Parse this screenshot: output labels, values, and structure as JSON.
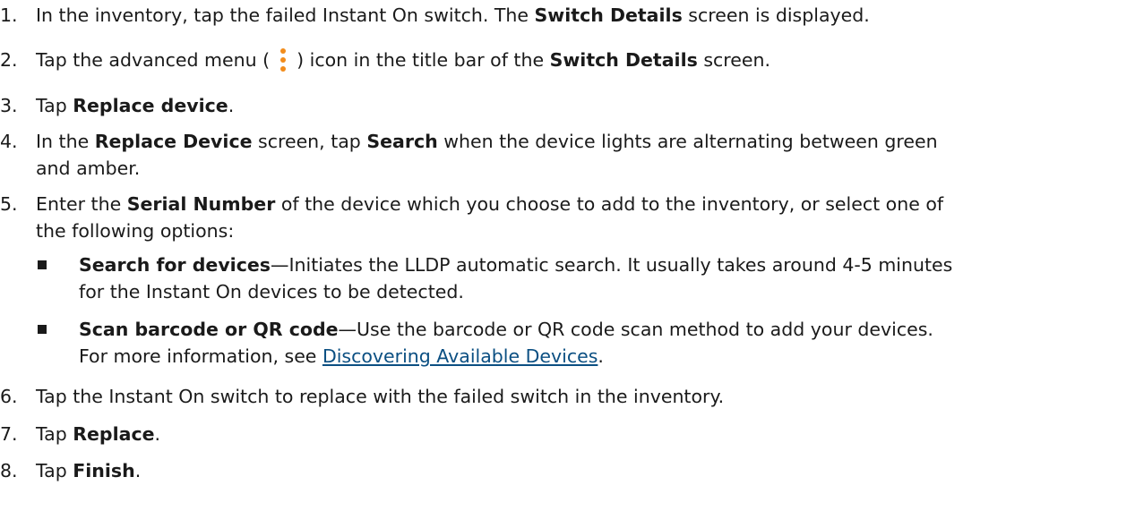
{
  "steps": [
    {
      "num": "1.",
      "pre": "In the inventory, tap the failed Instant On switch. The ",
      "bold": "Switch Details",
      "post": " screen is displayed."
    },
    {
      "num": "2.",
      "pre": "Tap the advanced menu (",
      "icon": "kebab-menu-icon",
      "mid": ") icon in the title bar of the ",
      "bold": "Switch Details",
      "post": " screen."
    },
    {
      "num": "3.",
      "pre": "Tap ",
      "bold": "Replace device",
      "post": "."
    },
    {
      "num": "4.",
      "pre": "In the ",
      "bold1": "Replace Device",
      "mid": " screen, tap ",
      "bold2": "Search",
      "post": " when the device lights are alternating between green",
      "cont": "and amber."
    },
    {
      "num": "5.",
      "pre": "Enter the ",
      "bold": "Serial Number",
      "post": " of the device which you choose to add to the inventory, or select one of",
      "cont": "the following options:",
      "options": [
        {
          "bold": "Search for devices",
          "text": "—Initiates the LLDP automatic search. It usually takes around 4-5 minutes",
          "cont": "for the Instant On devices to be detected."
        },
        {
          "bold": "Scan barcode or QR code",
          "text": "—Use the barcode or QR code scan method to add your devices.",
          "cont_pre": "For more information, see ",
          "link": "Discovering Available Devices",
          "cont_post": "."
        }
      ]
    },
    {
      "num": "6.",
      "text": "Tap the Instant On switch to replace with the failed switch in the inventory."
    },
    {
      "num": "7.",
      "pre": "Tap ",
      "bold": "Replace",
      "post": "."
    },
    {
      "num": "8.",
      "pre": "Tap ",
      "bold": "Finish",
      "post": "."
    }
  ],
  "colors": {
    "accent": "#f28c1b",
    "link": "#0b4f82",
    "text": "#1a1a1a"
  }
}
